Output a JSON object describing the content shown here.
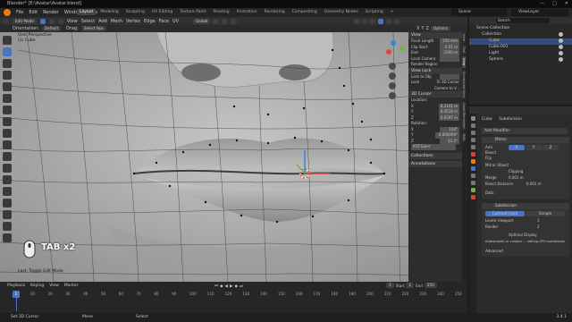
{
  "title_bar": {
    "title": "Blender* [E:\\Avatar\\Avatar.blend]",
    "controls": [
      "—",
      "□",
      "✕"
    ]
  },
  "top_menu": {
    "menus": [
      "File",
      "Edit",
      "Render",
      "Window",
      "Help"
    ],
    "workspace_tabs": [
      "Layout",
      "Modeling",
      "Sculpting",
      "UV Editing",
      "Texture Paint",
      "Shading",
      "Animation",
      "Rendering",
      "Compositing",
      "Geometry Nodes",
      "Scripting",
      "+"
    ],
    "active_tab": "Layout",
    "scene": "Scene",
    "view_layer": "ViewLayer"
  },
  "viewport_header": {
    "mode": "Edit Mode",
    "menus": [
      "View",
      "Select",
      "Add",
      "Mesh",
      "Vertex",
      "Edge",
      "Face",
      "UV"
    ],
    "transform_orientation": "Global",
    "orientation_label": "Orientation:",
    "orientation_value": "Default",
    "drag_label": "Drag:",
    "drag_value": "Select Box",
    "options": "Options",
    "axes": [
      "X",
      "Y",
      "Z"
    ]
  },
  "viewport": {
    "view_name": "User Perspective",
    "object_name": "(1) Cube",
    "key_overlay": "TAB x2",
    "last_op": "Last: Toggle Edit Mode",
    "gizmo": {
      "x_color": "#e0443c",
      "y_color": "#6bb642",
      "z_color": "#3b82d8"
    }
  },
  "n_panel": {
    "view": {
      "header": "View",
      "focal_label": "Focal Length",
      "focal_value": "250 mm",
      "clip_label": "Clip Start",
      "clip_value": "0.01 m",
      "end_label": "End",
      "end_value": "1000 m",
      "local_cam_label": "Local Camera",
      "render_region": "Render Region",
      "view_lock": "View Lock",
      "lock_obj_label": "Lock to Obj.",
      "lock_label": "Lock",
      "lock_3d_cursor": "To 3D Cursor",
      "camera_to_view": "Camera to V..."
    },
    "cursor": {
      "header": "3D Cursor",
      "location_label": "Location:",
      "x_label": "X",
      "x": "0.2141 m",
      "y_label": "Y",
      "y": "0.4518 m",
      "z_label": "Z",
      "z": "0.6597 m",
      "rotation_label": "Rotation:",
      "rx": "104°",
      "ry": "-0.000009°",
      "rz": "43.2°",
      "mode": "XYZ Euler"
    },
    "collections": "Collections",
    "annotations": "Annotations",
    "tabs": [
      "Item",
      "Tool",
      "View",
      "Screencast Keys",
      "Quad Remesher",
      "Edit"
    ]
  },
  "outliner": {
    "scene_collection": "Scene Collection",
    "items": [
      "Collection",
      "Cube",
      "Cube.001",
      "Light",
      "Sphere"
    ],
    "search_placeholder": "Search"
  },
  "properties": {
    "object_name": "Cube",
    "modifier_name": "Subdivision",
    "add_modifier": "Add Modifier",
    "mirror": {
      "name": "Mirror",
      "axis_label": "Axis",
      "bisect_label": "Bisect",
      "flip_label": "Flip",
      "axes": [
        "X",
        "Y",
        "Z"
      ],
      "mirror_object": "Mirror Object",
      "clipping": "Clipping",
      "merge_label": "Merge",
      "merge_value": "0.001 m",
      "bisect_distance_label": "Bisect Distance",
      "bisect_distance": "0.001 m",
      "data": "Data"
    },
    "subdivision": {
      "name": "Subdivision",
      "catmull": "Catmull-Clark",
      "simple": "Simple",
      "levels_label": "Levels Viewport",
      "levels": "1",
      "render_label": "Render",
      "render": "2",
      "optimal": "Optimal Display",
      "autosmooth": "Autosmooth or custom ... setting GPU subdivision",
      "advanced": "Advanced"
    }
  },
  "timeline": {
    "menus": [
      "Playback",
      "Keying",
      "View",
      "Marker"
    ],
    "frame": "1",
    "start_label": "Start",
    "start": "1",
    "end_label": "End",
    "end": "250",
    "ticks": [
      "0",
      "10",
      "20",
      "30",
      "40",
      "50",
      "60",
      "70",
      "80",
      "90",
      "100",
      "110",
      "120",
      "130",
      "140",
      "150",
      "160",
      "170",
      "180",
      "190",
      "200",
      "210",
      "220",
      "230",
      "240",
      "250"
    ]
  },
  "status_bar": {
    "left": "Set 3D Cursor",
    "middle1": "Move",
    "middle2": "Select",
    "version": "3.4.1"
  }
}
